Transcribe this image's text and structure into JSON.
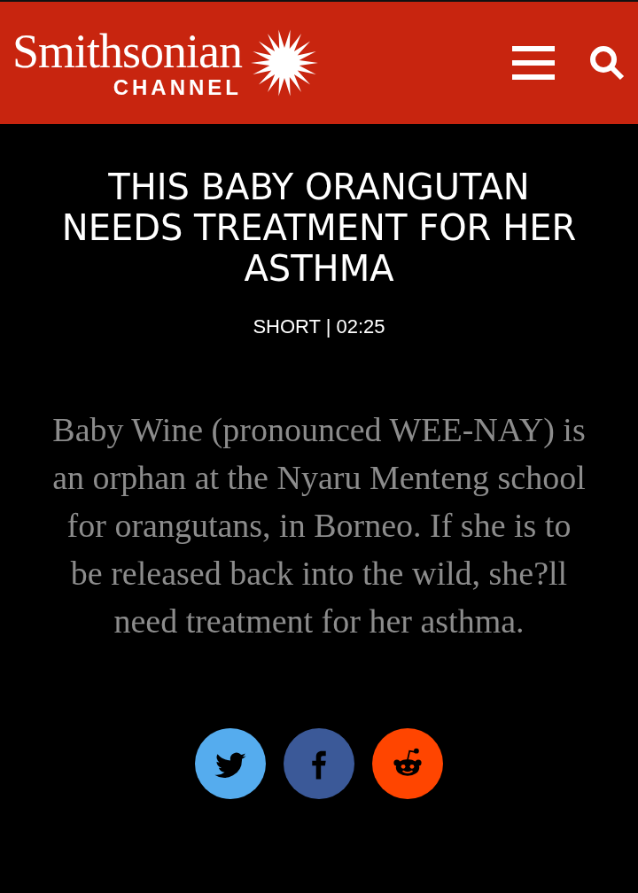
{
  "header": {
    "logo_name": "Smithsonian",
    "logo_sub": "CHANNEL"
  },
  "video": {
    "title": "THIS BABY ORANGUTAN NEEDS TREATMENT FOR HER ASTHMA",
    "meta": "SHORT | 02:25",
    "description": "Baby Wine (pronounced WEE-NAY) is an orphan at the Nyaru Menteng school for orangutans, in Borneo. If she is to be released back into the wild, she?ll need treatment for her asthma."
  },
  "share_buttons": [
    {
      "kind": "bird",
      "color": "#55acee"
    },
    {
      "kind": "f",
      "color": "#3b5998"
    },
    {
      "kind": "alien",
      "color": "#ff4500"
    }
  ]
}
